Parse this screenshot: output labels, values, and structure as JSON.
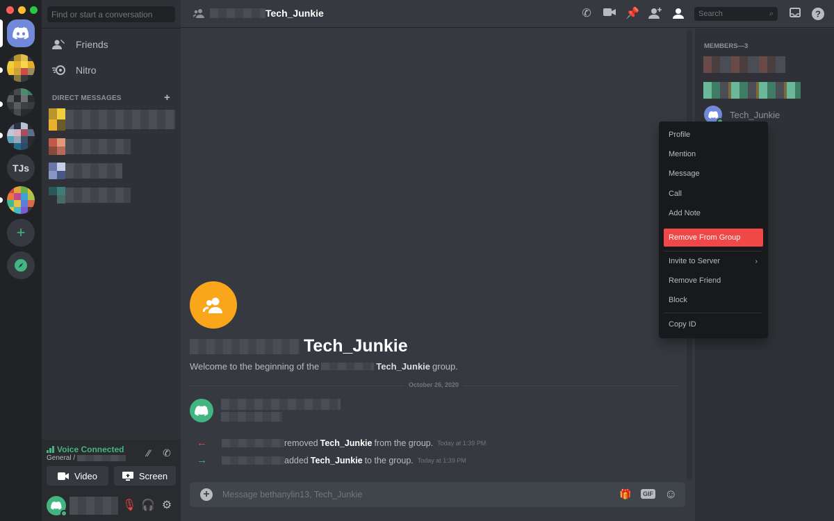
{
  "window": {
    "traffic_colors": [
      "#ff5f57",
      "#febc2e",
      "#28c840"
    ]
  },
  "servers": [
    {
      "kind": "home",
      "icon": "discord-logo-icon"
    },
    {
      "kind": "avatar",
      "colors": [
        "#3a3b3f",
        "#b8962b",
        "#e0c04a",
        "#3a3b3f",
        "#f0cc3f",
        "#e8b22f",
        "#f7d64a",
        "#e5ad2e",
        "#f2c235",
        "#cda23a",
        "#d14a4a",
        "#9b8b5a",
        "#2a2b2f",
        "#8a7a40",
        "#3a3b3f",
        "#2a2b2f"
      ]
    },
    {
      "kind": "avatar",
      "colors": [
        "#2a2b2f",
        "#48494d",
        "#4f8a6a",
        "#3e7d5e",
        "#5b5d62",
        "#2a2b2f",
        "#6d6f74",
        "#2a2b2f",
        "#3a3b3f",
        "#5a5c60",
        "#3e4044",
        "#3a3b3f",
        "#2a2b2f",
        "#4a4b4f",
        "#2a2b2f",
        "#2a2b2f"
      ]
    },
    {
      "kind": "avatar",
      "colors": [
        "#6c7a96",
        "#2a3344",
        "#b4c2d4",
        "#2a2b2f",
        "#c0c8d8",
        "#d7b3c2",
        "#a64d62",
        "#5c6f8a",
        "#58a3b8",
        "#9aa6b5",
        "#3a5064",
        "#2a2b2f",
        "#2a2b2f",
        "#1f6b8a",
        "#2e4a6a",
        "#2a2b2f"
      ]
    },
    {
      "kind": "text",
      "label": "TJs"
    },
    {
      "kind": "avatar",
      "colors": [
        "#d04646",
        "#e0a43a",
        "#6ab04c",
        "#d9b83c",
        "#e87a3c",
        "#c34a8a",
        "#3fa0d6",
        "#a8c44a",
        "#3fb89a",
        "#e3c046",
        "#5c7ed8",
        "#d86a4a",
        "#e0c24a",
        "#4ab8c4",
        "#7a5cd0",
        "#3a3b3f"
      ]
    },
    {
      "kind": "add",
      "icon": "plus-icon"
    },
    {
      "kind": "explore",
      "icon": "compass-icon"
    }
  ],
  "sidebar": {
    "search_placeholder": "Find or start a conversation",
    "nav": [
      {
        "label": "Friends",
        "icon": "friends-icon"
      },
      {
        "label": "Nitro",
        "icon": "nitro-icon"
      }
    ],
    "dm_header": "DIRECT MESSAGES",
    "dm_add": "+",
    "dms": [
      {
        "avatar_colors": [
          "#b8962b",
          "#f0cc3f",
          "#e8b22f",
          "#6b5a2a"
        ]
      },
      {
        "avatar_colors": [
          "#c05a4a",
          "#e09878",
          "#8a4a3a",
          "#b66a5a"
        ]
      },
      {
        "avatar_colors": [
          "#6a78a8",
          "#c4cee6",
          "#8896c4",
          "#4a5684"
        ]
      },
      {
        "avatar_colors": [
          "#2a5a58",
          "#3e7c78",
          "#2f3136",
          "#4a6a68"
        ]
      }
    ]
  },
  "voice": {
    "status": "Voice Connected",
    "channel": "General /",
    "video_label": "Video",
    "screen_label": "Screen"
  },
  "header": {
    "group_name": "Tech_Junkie",
    "search_placeholder": "Search"
  },
  "chat": {
    "group_name": "Tech_Junkie",
    "welcome_prefix": "Welcome to the beginning of the",
    "welcome_name": "Tech_Junkie",
    "welcome_suffix": "group.",
    "date": "October 26, 2020",
    "system_messages": [
      {
        "arrow": "←",
        "arrow_color": "#f04747",
        "action": "removed",
        "target": "Tech_Junkie",
        "tail": "from the group.",
        "time": "Today at 1:39 PM"
      },
      {
        "arrow": "→",
        "arrow_color": "#43b581",
        "action": "added",
        "target": "Tech_Junkie",
        "tail": "to the group.",
        "time": "Today at 1:39 PM"
      }
    ],
    "composer_placeholder": "Message bethanylin13, Tech_Junkie"
  },
  "members": {
    "header": "MEMBERS—3",
    "visible_name": "Tech_Junkie"
  },
  "context_menu": {
    "items": [
      "Profile",
      "Mention",
      "Message",
      "Call",
      "Add Note"
    ],
    "danger": "Remove From Group",
    "items2": [
      "Invite to Server",
      "Remove Friend",
      "Block"
    ],
    "copy": "Copy ID"
  },
  "colors": {
    "accent": "#7289da",
    "online": "#43b581",
    "danger": "#f04747",
    "group_icon": "#faa61a"
  }
}
